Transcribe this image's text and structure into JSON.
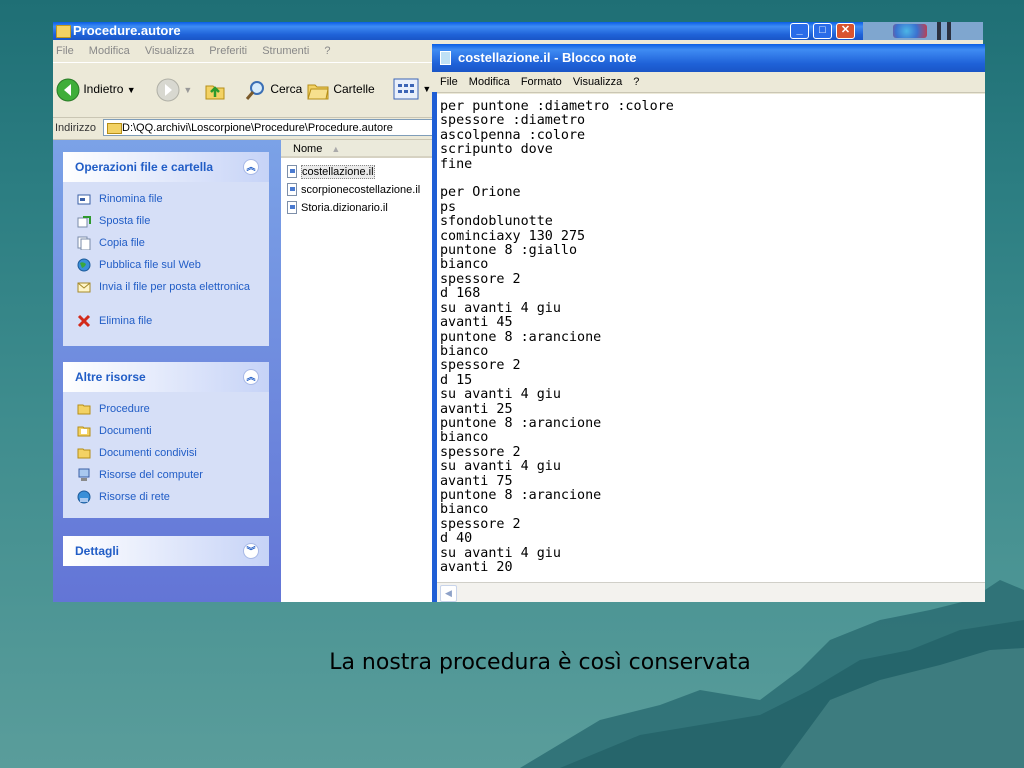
{
  "explorer": {
    "title": "Procedure.autore",
    "menu": [
      "File",
      "Modifica",
      "Visualizza",
      "Preferiti",
      "Strumenti",
      "?"
    ],
    "toolbar": {
      "back_label": "Indietro",
      "search_label": "Cerca",
      "folders_label": "Cartelle"
    },
    "address": {
      "label": "Indirizzo",
      "value": "D:\\QQ.archivi\\Loscorpione\\Procedure\\Procedure.autore"
    },
    "task_pane": {
      "file_tasks": {
        "title": "Operazioni file e cartella",
        "items": [
          "Rinomina file",
          "Sposta file",
          "Copia file",
          "Pubblica file sul Web",
          "Invia il file per posta elettronica",
          "Elimina file"
        ]
      },
      "other_places": {
        "title": "Altre risorse",
        "items": [
          "Procedure",
          "Documenti",
          "Documenti condivisi",
          "Risorse del computer",
          "Risorse di rete"
        ]
      },
      "details": {
        "title": "Dettagli"
      }
    },
    "file_list": {
      "column_name": "Nome",
      "files": [
        "costellazione.il",
        "scorpionecostellazione.il",
        "Storia.dizionario.il"
      ]
    }
  },
  "notepad": {
    "title": "costellazione.il - Blocco note",
    "menu": [
      "File",
      "Modifica",
      "Formato",
      "Visualizza",
      "?"
    ],
    "content": "per puntone :diametro :colore\nspessore :diametro\nascolpenna :colore\nscripunto dove\nfine\n\nper Orione\nps\nsfondoblunotte\ncominciaxy 130 275\npuntone 8 :giallo\nbianco\nspessore 2\nd 168\nsu avanti 4 giu\navanti 45\npuntone 8 :arancione\nbianco\nspessore 2\nd 15\nsu avanti 4 giu\navanti 25\npuntone 8 :arancione\nbianco\nspessore 2\nsu avanti 4 giu\navanti 75\npuntone 8 :arancione\nbianco\nspessore 2\nd 40\nsu avanti 4 giu\navanti 20"
  },
  "caption": "La nostra procedura è così conservata",
  "colors": {
    "xp_blue": "#1f62d8",
    "taskpane_link": "#215dc6",
    "background_teal": "#2c7e82"
  }
}
